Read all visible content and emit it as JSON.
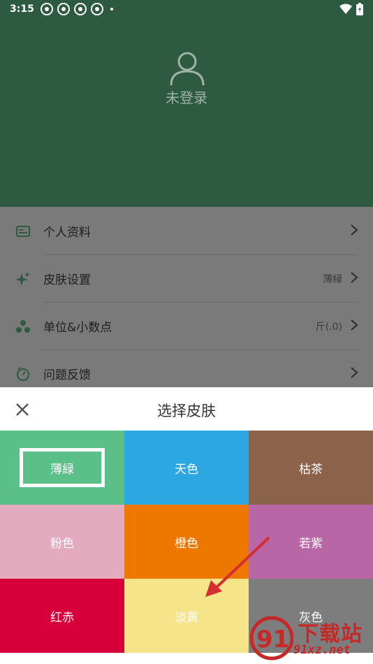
{
  "status_bar": {
    "time": "3:15"
  },
  "profile": {
    "login_text": "未登录"
  },
  "menu": {
    "items": [
      {
        "label": "个人资料",
        "value": "",
        "icon": "id-card-icon"
      },
      {
        "label": "皮肤设置",
        "value": "薄緑",
        "icon": "sparkle-icon"
      },
      {
        "label": "单位&小数点",
        "value": "斤(.0)",
        "icon": "dots-cluster-icon"
      },
      {
        "label": "问题反馈",
        "value": "",
        "icon": "timer-icon"
      }
    ]
  },
  "sheet": {
    "title": "选择皮肤",
    "close_icon": "close-icon",
    "swatches": [
      {
        "label": "薄緑",
        "color": "#5bbf88",
        "selected": true
      },
      {
        "label": "天色",
        "color": "#2da7e2"
      },
      {
        "label": "枯茶",
        "color": "#8b624a"
      },
      {
        "label": "粉色",
        "color": "#e3abbd"
      },
      {
        "label": "橙色",
        "color": "#ee7700"
      },
      {
        "label": "若紫",
        "color": "#b866a6"
      },
      {
        "label": "红赤",
        "color": "#d8003a"
      },
      {
        "label": "淡黄",
        "color": "#f6e48a"
      },
      {
        "label": "灰色",
        "color": "#7d7d7d"
      }
    ]
  },
  "watermark": {
    "text_cn": "下载站",
    "text_url": "91xz.net",
    "logo_text": "91"
  }
}
